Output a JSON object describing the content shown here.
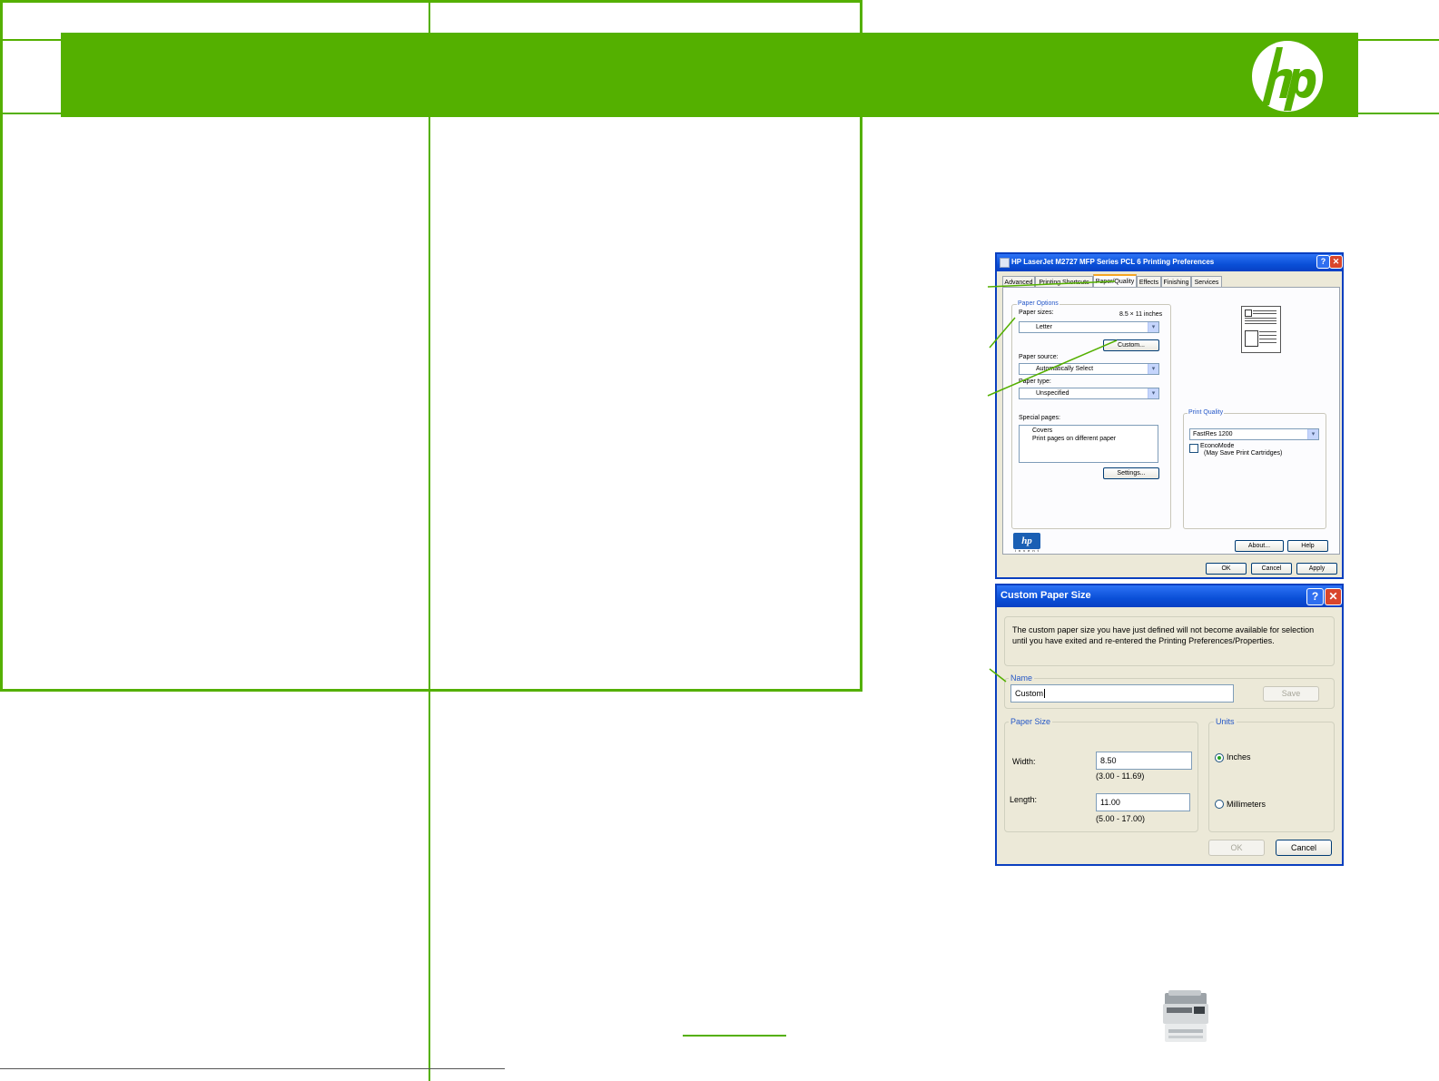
{
  "colors": {
    "brand_green": "#54b000",
    "xp_title_blue": "#0a4fd7",
    "xp_face": "#ece9d8"
  },
  "printing_preferences": {
    "title": "HP LaserJet M2727 MFP Series PCL 6 Printing Preferences",
    "tabs": [
      "Advanced",
      "Printing Shortcuts",
      "Paper/Quality",
      "Effects",
      "Finishing",
      "Services"
    ],
    "active_tab": "Paper/Quality",
    "paper_options": {
      "group_label": "Paper Options",
      "paper_sizes_label": "Paper sizes:",
      "paper_size_dimensions": "8.5 × 11 inches",
      "paper_size_value": "Letter",
      "custom_button": "Custom...",
      "paper_source_label": "Paper source:",
      "paper_source_value": "Automatically Select",
      "paper_type_label": "Paper type:",
      "paper_type_value": "Unspecified",
      "special_pages_label": "Special pages:",
      "special_pages_items": [
        "Covers",
        "Print pages on different paper"
      ],
      "settings_button": "Settings..."
    },
    "print_quality": {
      "group_label": "Print Quality",
      "value": "FastRes 1200",
      "economode_label": "EconoMode",
      "economode_note": "(May Save Print Cartridges)",
      "economode_checked": false
    },
    "logo_text": "hp",
    "logo_subtext": "invent",
    "buttons": {
      "about": "About...",
      "help": "Help",
      "ok": "OK",
      "cancel": "Cancel",
      "apply": "Apply"
    }
  },
  "custom_paper_size": {
    "title": "Custom Paper Size",
    "notice": "The custom paper size you have just defined will not become available for selection until you have exited and re-entered the Printing Preferences/Properties.",
    "name_label": "Name",
    "name_value": "Custom",
    "save_button": "Save",
    "paper_size_group": "Paper Size",
    "width_label": "Width:",
    "width_value": "8.50",
    "width_range": "(3.00 - 11.69)",
    "length_label": "Length:",
    "length_value": "11.00",
    "length_range": "(5.00 - 17.00)",
    "units_group": "Units",
    "unit_inches": "Inches",
    "unit_millimeters": "Millimeters",
    "selected_unit": "Inches",
    "ok_button": "OK",
    "cancel_button": "Cancel"
  }
}
